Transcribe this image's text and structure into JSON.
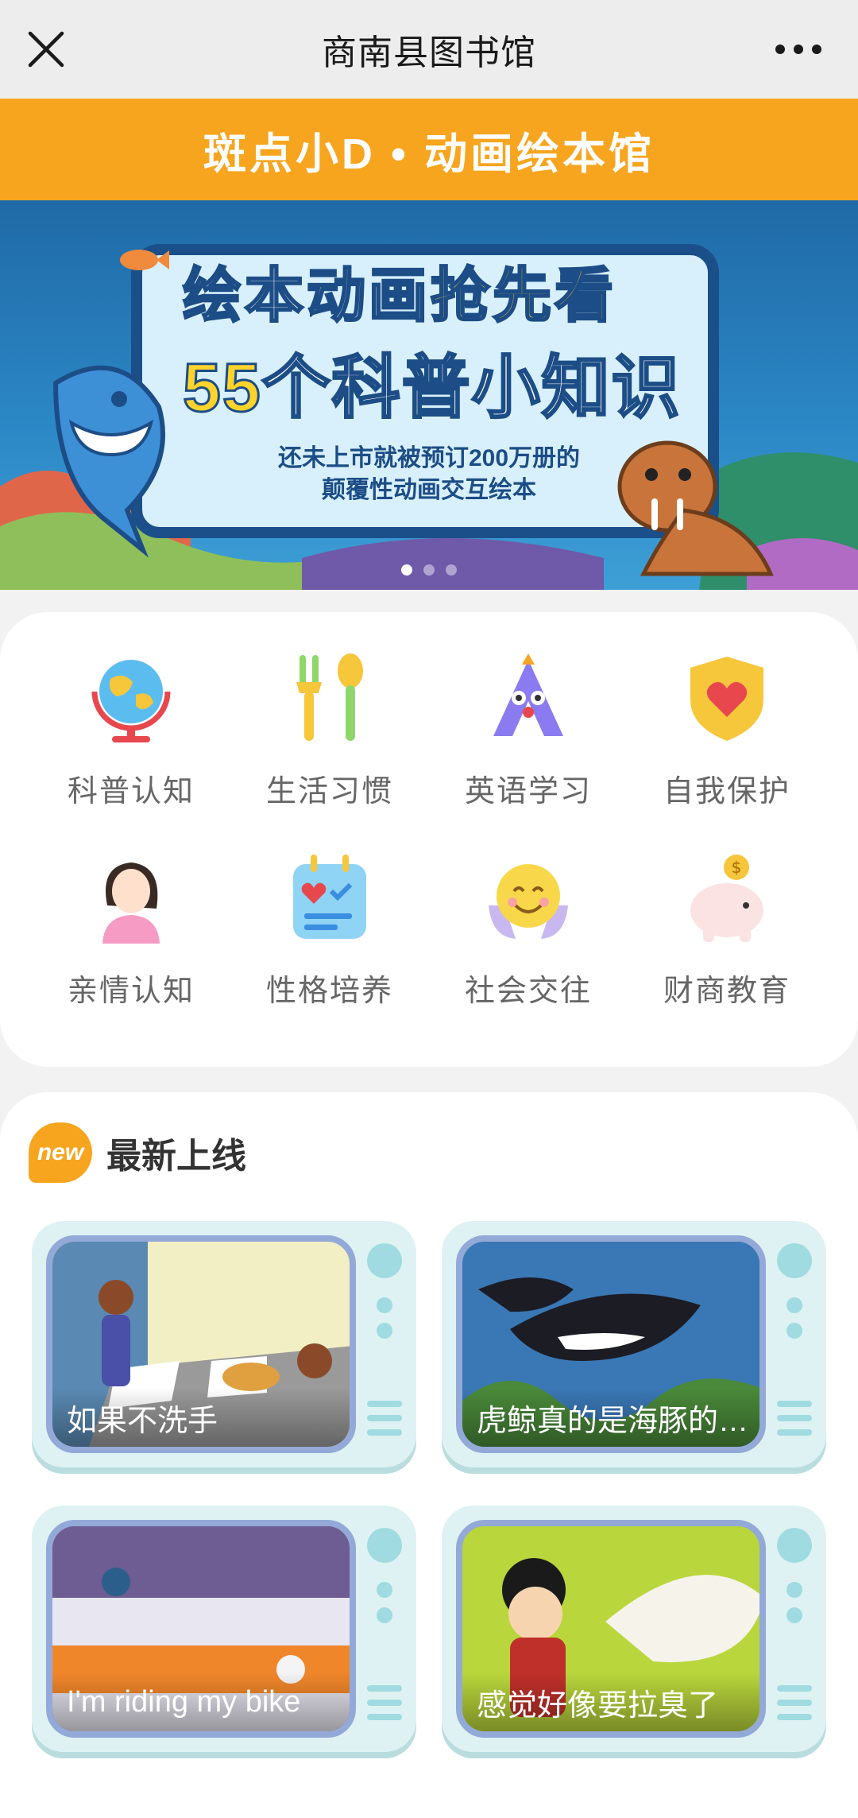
{
  "header": {
    "title": "商南县图书馆",
    "close_icon": "close-icon",
    "more_icon": "more-icon"
  },
  "brand": {
    "title": "斑点小D • 动画绘本馆"
  },
  "banner": {
    "line1_a": "绘本动画",
    "line1_b": "抢先看",
    "line2_num": "55",
    "line2_text": "个科普小知识",
    "sub1": "还未上市就被预订200万册的",
    "sub2": "颠覆性动画交互绘本"
  },
  "categories": [
    {
      "label": "科普认知",
      "icon": "globe-icon"
    },
    {
      "label": "生活习惯",
      "icon": "fork-spoon-icon"
    },
    {
      "label": "英语学习",
      "icon": "letter-a-icon"
    },
    {
      "label": "自我保护",
      "icon": "shield-heart-icon"
    },
    {
      "label": "亲情认知",
      "icon": "mother-icon"
    },
    {
      "label": "性格培养",
      "icon": "calendar-heart-icon"
    },
    {
      "label": "社会交往",
      "icon": "smile-face-icon"
    },
    {
      "label": "财商教育",
      "icon": "piggy-bank-icon"
    }
  ],
  "newest": {
    "badge": "new",
    "title": "最新上线",
    "items": [
      {
        "caption": "如果不洗手"
      },
      {
        "caption": "虎鲸真的是海豚的…"
      },
      {
        "caption": "I'm riding my bike"
      },
      {
        "caption": "感觉好像要拉臭了"
      }
    ]
  },
  "colors": {
    "brand_orange": "#f7a51f",
    "nav_bg": "#ededed",
    "tv_body": "#dff2f3",
    "tv_frame": "#93a9d8"
  }
}
